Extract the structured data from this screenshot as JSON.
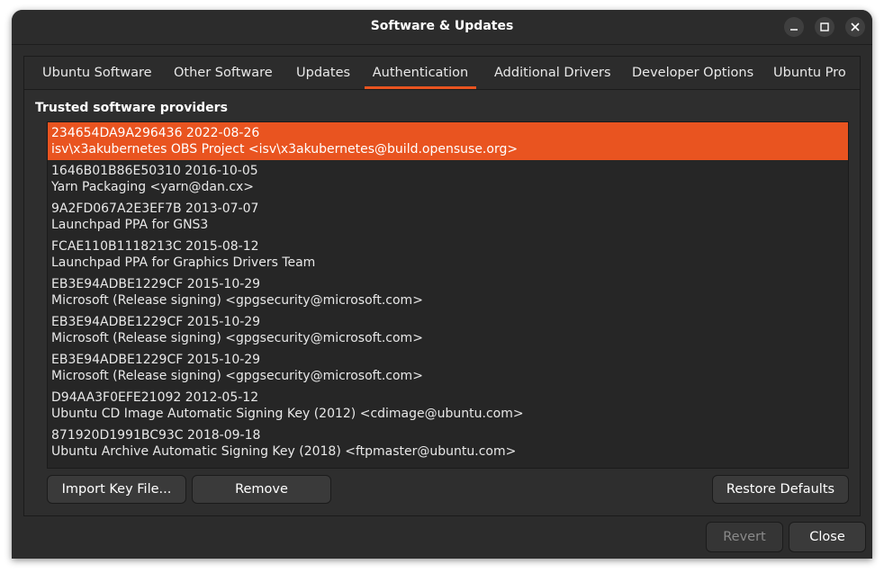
{
  "window": {
    "title": "Software & Updates",
    "controls": {
      "minimize": "–",
      "maximize": "□",
      "close": "✕"
    }
  },
  "tabs": [
    {
      "label": "Ubuntu Software",
      "active": false
    },
    {
      "label": "Other Software",
      "active": false
    },
    {
      "label": "Updates",
      "active": false
    },
    {
      "label": "Authentication",
      "active": true
    },
    {
      "label": "Additional Drivers",
      "active": false
    },
    {
      "label": "Developer Options",
      "active": false
    },
    {
      "label": "Ubuntu Pro",
      "active": false
    }
  ],
  "auth": {
    "section_title": "Trusted software providers",
    "keys": [
      {
        "id_date": "234654DA9A296436 2022-08-26",
        "owner": "isv\\x3akubernetes OBS Project <isv\\x3akubernetes@build.opensuse.org>",
        "selected": true
      },
      {
        "id_date": "1646B01B86E50310 2016-10-05",
        "owner": "Yarn Packaging <yarn@dan.cx>",
        "selected": false
      },
      {
        "id_date": "9A2FD067A2E3EF7B 2013-07-07",
        "owner": "Launchpad PPA for GNS3",
        "selected": false
      },
      {
        "id_date": "FCAE110B1118213C 2015-08-12",
        "owner": "Launchpad PPA for Graphics Drivers Team",
        "selected": false
      },
      {
        "id_date": "EB3E94ADBE1229CF 2015-10-29",
        "owner": "Microsoft (Release signing) <gpgsecurity@microsoft.com>",
        "selected": false
      },
      {
        "id_date": "EB3E94ADBE1229CF 2015-10-29",
        "owner": "Microsoft (Release signing) <gpgsecurity@microsoft.com>",
        "selected": false
      },
      {
        "id_date": "EB3E94ADBE1229CF 2015-10-29",
        "owner": "Microsoft (Release signing) <gpgsecurity@microsoft.com>",
        "selected": false
      },
      {
        "id_date": "D94AA3F0EFE21092 2012-05-12",
        "owner": "Ubuntu CD Image Automatic Signing Key (2012) <cdimage@ubuntu.com>",
        "selected": false
      },
      {
        "id_date": "871920D1991BC93C 2018-09-18",
        "owner": "Ubuntu Archive Automatic Signing Key (2018) <ftpmaster@ubuntu.com>",
        "selected": false
      }
    ],
    "buttons": {
      "import": "Import Key File...",
      "remove": "Remove",
      "restore": "Restore Defaults"
    }
  },
  "dialog_buttons": {
    "revert": "Revert",
    "close": "Close"
  },
  "colors": {
    "accent": "#e95420",
    "background": "#2c2c2c"
  }
}
